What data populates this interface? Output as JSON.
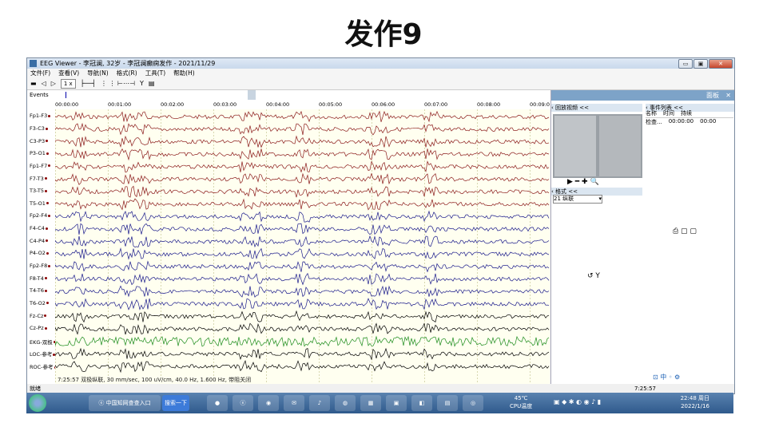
{
  "slide_title": "发作9",
  "window": {
    "title": "EEG Viewer - 李冠澜, 32岁 - 李冠澜癫痫发作 - 2021/11/29",
    "controls": [
      "▭",
      "▣",
      "✕"
    ]
  },
  "menu": [
    "文件(F)",
    "查看(V)",
    "导航(N)",
    "格式(R)",
    "工具(T)",
    "帮助(H)"
  ],
  "toolbar": {
    "zoom": "1 x",
    "icons": [
      "◁",
      "▷",
      "Y"
    ]
  },
  "events_label": "Events",
  "time_ticks": [
    "00:00:00",
    "00:01:00",
    "00:02:00",
    "00:03:00",
    "00:04:00",
    "00:05:00",
    "00:06:00",
    "00:07:00",
    "00:08:00",
    "00:09:0"
  ],
  "channels": [
    "Fp1-F3",
    "F3-C3",
    "C3-P3",
    "P3-O1",
    "Fp1-F7",
    "F7-T3",
    "T3-T5",
    "T5-O1",
    "Fp2-F4",
    "F4-C4",
    "C4-P4",
    "P4-O2",
    "Fp2-F8",
    "F8-T4",
    "T4-T6",
    "T6-O2",
    "Fz-Cz",
    "Cz-Pz",
    "EKG-双极",
    "LOC-参考",
    "ROC-参考"
  ],
  "channel_colors": {
    "left": "#8b1a1a",
    "right": "#1a1a8b",
    "mid": "#000000",
    "ekg": "#1a8b1a"
  },
  "caption": "7:25:57 双极纵联, 30 mm/sec, 100 uV/cm, 40.0 Hz, 1.600 Hz, 带阻关闭",
  "status": {
    "left": "就绪",
    "right": "7:25:57"
  },
  "panel": {
    "title": "面板",
    "video_header": "回放视频 <<",
    "events_header": "事件列表 <<",
    "format_header": "格式 <<",
    "format_value": "21    纵联",
    "events_columns": [
      "名称",
      "时间",
      "持续"
    ],
    "events_rows": [
      [
        "检查...",
        "00:00:00",
        "00:00"
      ]
    ],
    "video_controls": "▶ ━ ✚ 🔍"
  },
  "taskbar": {
    "browser_tab": "中国知网查查入口",
    "search_btn": "搜索一下",
    "cpu_temp": "45℃",
    "cpu_label": "CPU温度",
    "time": "22:48 周日",
    "date": "2022/1/16"
  }
}
